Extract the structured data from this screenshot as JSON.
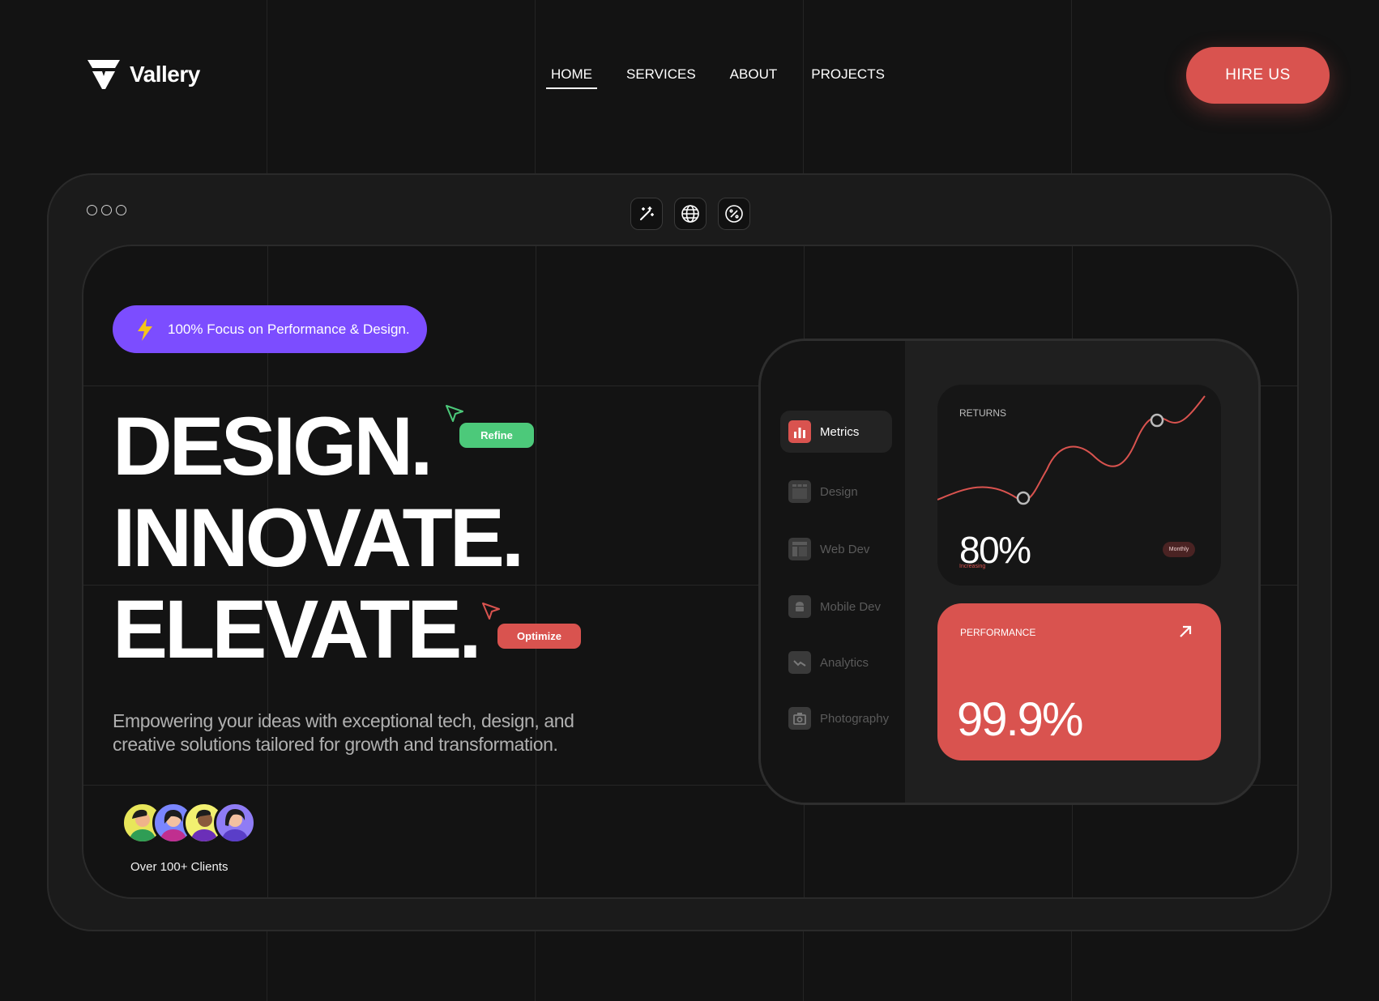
{
  "brand": {
    "name": "Vallery"
  },
  "nav": {
    "items": [
      {
        "label": "HOME",
        "active": true
      },
      {
        "label": "SERVICES",
        "active": false
      },
      {
        "label": "ABOUT",
        "active": false
      },
      {
        "label": "PROJECTS",
        "active": false
      }
    ],
    "cta": "HIRE US"
  },
  "colors": {
    "accent": "#d9534f",
    "purple": "#7c4dff",
    "green": "#4cc97a",
    "background": "#131313"
  },
  "toolbar": {
    "icons": [
      "magic-wand-icon",
      "globe-icon",
      "percent-badge-icon"
    ]
  },
  "hero": {
    "badge": "100% Focus on Performance & Design.",
    "headline": [
      "DESIGN.",
      "INNOVATE.",
      "ELEVATE."
    ],
    "tags": {
      "refine": "Refine",
      "optimize": "Optimize"
    },
    "description_line1": "Empowering your ideas with exceptional tech, design, and",
    "description_line2": "creative solutions tailored for growth and transformation.",
    "clients": "Over 100+ Clients"
  },
  "dashboard": {
    "menu": [
      {
        "label": "Metrics",
        "icon": "bar-chart-icon",
        "active": true
      },
      {
        "label": "Design",
        "icon": "design-icon",
        "active": false
      },
      {
        "label": "Web Dev",
        "icon": "layout-icon",
        "active": false
      },
      {
        "label": "Mobile Dev",
        "icon": "android-icon",
        "active": false
      },
      {
        "label": "Analytics",
        "icon": "trend-icon",
        "active": false
      },
      {
        "label": "Photography",
        "icon": "camera-icon",
        "active": false
      }
    ],
    "returns": {
      "label": "RETURNS",
      "status": "Increasing",
      "value": "80%",
      "period": "Monthly"
    },
    "performance": {
      "label": "PERFORMANCE",
      "value": "99.9%"
    }
  }
}
